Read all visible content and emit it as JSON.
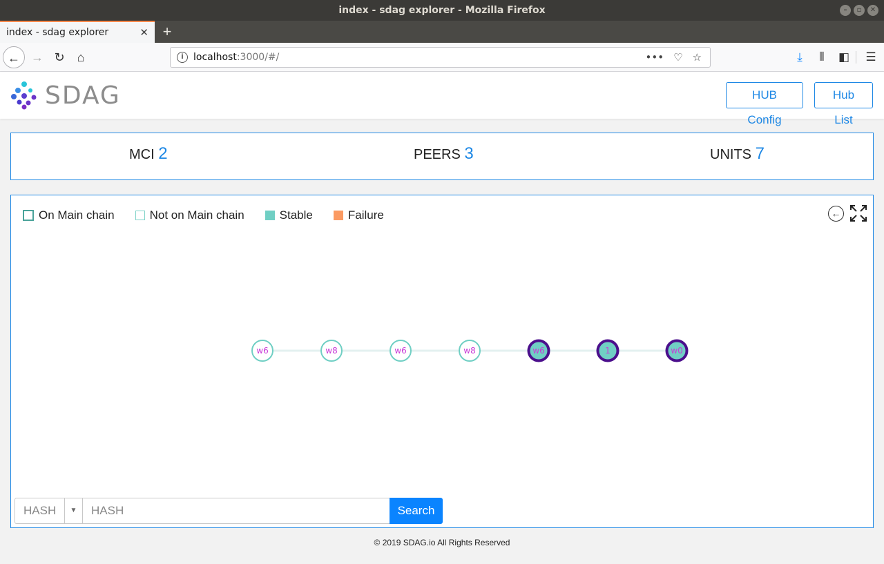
{
  "window": {
    "title": "index - sdag explorer - Mozilla Firefox"
  },
  "browser": {
    "tab_title": "index - sdag explorer",
    "url_host": "localhost",
    "url_path": ":3000/#/"
  },
  "header": {
    "logo_text": "SDAG",
    "hub_config": "HUB Config",
    "hub_list": "Hub List"
  },
  "stats": {
    "mci_label": "MCI",
    "mci_value": "2",
    "peers_label": "PEERS",
    "peers_value": "3",
    "units_label": "UNITS",
    "units_value": "7"
  },
  "legend": {
    "main_chain": "On Main chain",
    "not_main_chain": "Not on Main chain",
    "stable": "Stable",
    "failure": "Failure"
  },
  "colors": {
    "accent": "#1e88e5",
    "stable": "#70cfc4",
    "failure": "#fb9a62",
    "main_chain_border": "#4b0f8c",
    "node_label": "#c93bd8"
  },
  "nodes": [
    {
      "label": "w6",
      "main_chain": false,
      "stable": false
    },
    {
      "label": "w8",
      "main_chain": false,
      "stable": false
    },
    {
      "label": "w6",
      "main_chain": false,
      "stable": false
    },
    {
      "label": "w8",
      "main_chain": false,
      "stable": false
    },
    {
      "label": "w6",
      "main_chain": true,
      "stable": true
    },
    {
      "label": "1",
      "main_chain": true,
      "stable": true
    },
    {
      "label": "w0",
      "main_chain": true,
      "stable": true
    }
  ],
  "search": {
    "type_selected": "HASH",
    "placeholder": "HASH",
    "button": "Search"
  },
  "footer": "© 2019 SDAG.io All Rights Reserved"
}
